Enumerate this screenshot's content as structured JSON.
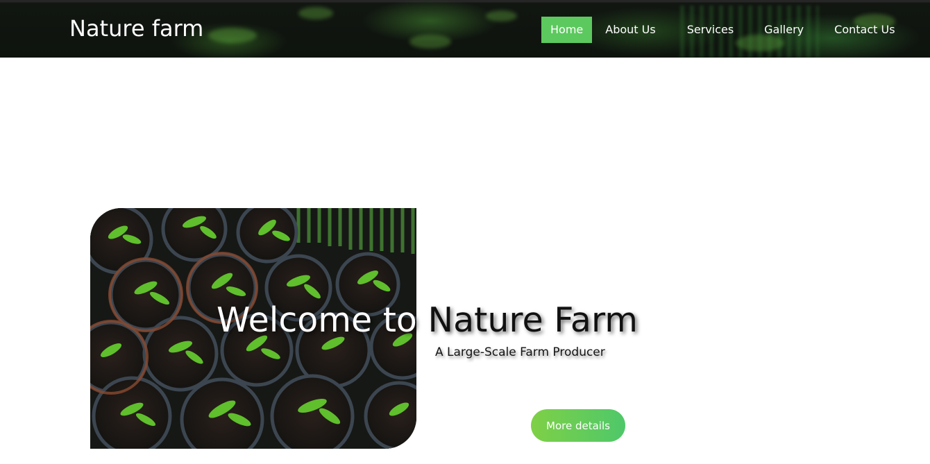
{
  "header": {
    "brand": "Nature farm",
    "nav": {
      "home": "Home",
      "about": "About Us",
      "services": "Services",
      "gallery": "Gallery",
      "contact": "Contact Us"
    },
    "active_item": "Home",
    "accent_color": "#5cc95e"
  },
  "hero": {
    "title_part1": "Welcome to ",
    "title_part2": "Nature Farm",
    "subtitle": "A Large-Scale Farm Producer",
    "button_label": "More details",
    "image": "seedlings in pots photo"
  }
}
